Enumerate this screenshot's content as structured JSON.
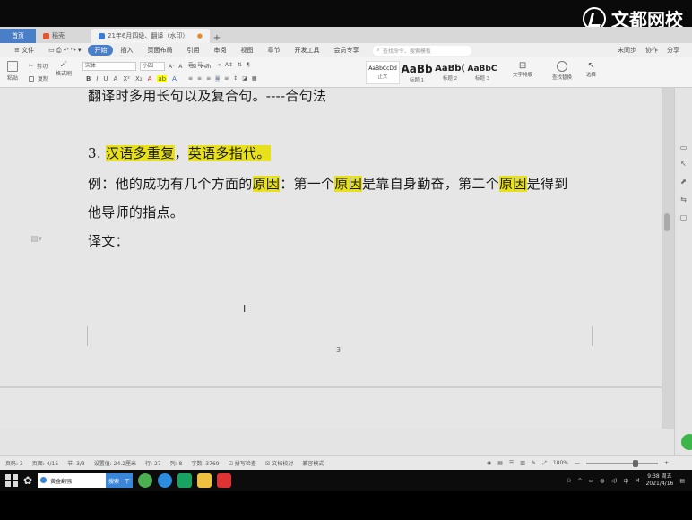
{
  "watermark": {
    "text": "文都网校"
  },
  "tabs": {
    "home": "首页",
    "docer": "稻壳",
    "doc": "21年6月四级、翻译（水印）"
  },
  "menu": {
    "file": "文件",
    "items": [
      "开始",
      "插入",
      "页面布局",
      "引用",
      "审阅",
      "视图",
      "章节",
      "开发工具",
      "会员专享"
    ],
    "active_index": 0,
    "search_placeholder": "查找命令、搜索模板",
    "right": [
      "未同步",
      "协作",
      "分享"
    ]
  },
  "ribbon": {
    "paste": "粘贴",
    "cut": "剪切",
    "copy": "复制",
    "format_painter": "格式刷",
    "font_name": "宋体",
    "font_size": "小四",
    "styles": [
      {
        "sample": "AaBbCcDd",
        "label": "正文"
      },
      {
        "sample": "AaBb",
        "label": "标题 1"
      },
      {
        "sample": "AaBb(",
        "label": "标题 2"
      },
      {
        "sample": "AaBbC",
        "label": "标题 3"
      }
    ],
    "text_layout": "文字排版",
    "find_replace": "查找替换",
    "select": "选择"
  },
  "document": {
    "line1": "翻译时多用长句以及复合句。----合句法",
    "line2_num": "3.",
    "line2_hl1": "汉语多重复",
    "line2_sep": "，",
    "line2_hl2": "英语多指代。",
    "line3_a": "例：他的成功有几个方面的",
    "line3_hl1": "原因",
    "line3_b": "：第一个",
    "line3_hl2": "原因",
    "line3_c": "是靠自身勤奋，第二个",
    "line3_hl3": "原因",
    "line3_d": "是得到",
    "line4": "他导师的指点。",
    "line5": "译文：",
    "page_number": "3"
  },
  "statusbar": {
    "page": "页码: 3",
    "pages": "页面: 4/15",
    "section": "节: 3/3",
    "position": "设置值: 24.2厘米",
    "line": "行: 27",
    "col": "列: 8",
    "words": "字数: 3769",
    "spell": "拼写检查",
    "doc_check": "文档校对",
    "compat": "兼容模式",
    "zoom": "180%"
  },
  "taskbar": {
    "search_text": "黄金翻强",
    "search_btn": "搜索一下",
    "ime": "中",
    "time": "9:38 周五",
    "date": "2021/4/16"
  }
}
